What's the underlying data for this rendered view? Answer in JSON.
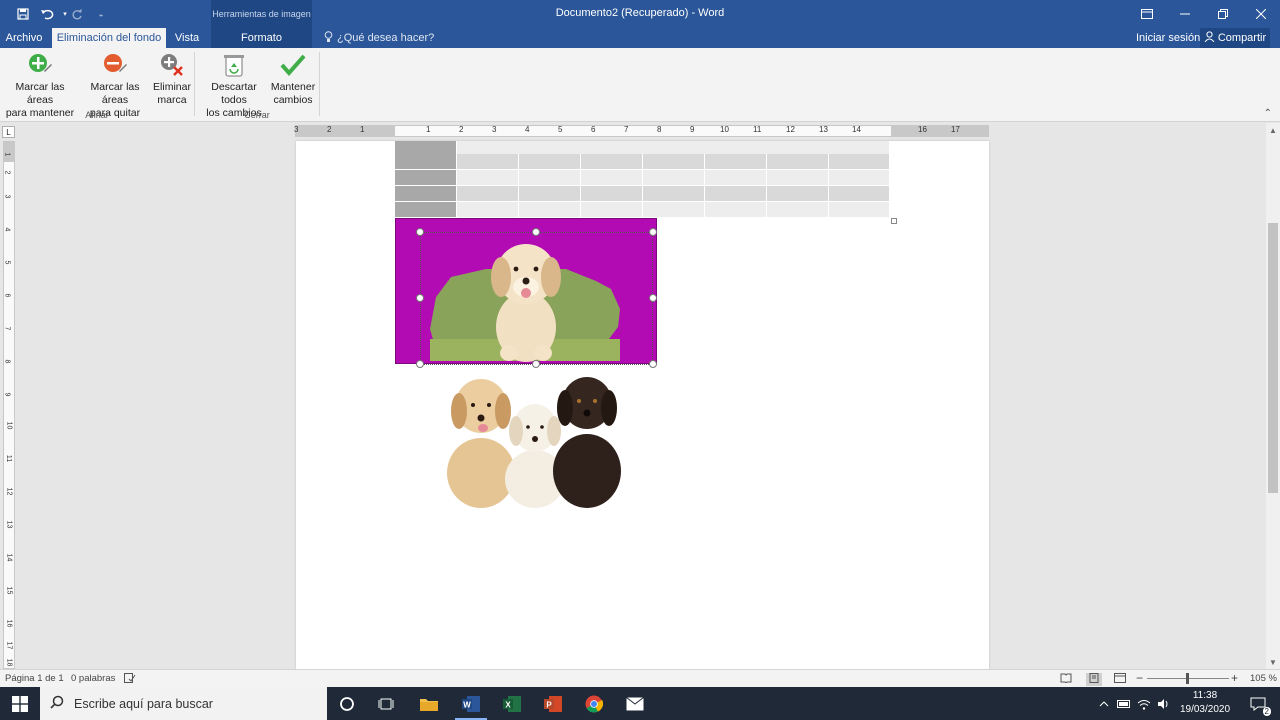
{
  "titlebar": {
    "document_title": "Documento2 (Recuperado)  -  Word",
    "contextual_header": "Herramientas de imagen",
    "qa_icons": [
      "save-icon",
      "undo-icon",
      "redo-icon",
      "customize-icon"
    ]
  },
  "tabs": {
    "archivo": "Archivo",
    "eliminacion": "Eliminación del fondo",
    "vista": "Vista",
    "formato": "Formato",
    "tell_me": "¿Qué desea hacer?",
    "sign_in": "Iniciar sesión",
    "share": "Compartir"
  },
  "ribbon": {
    "mark_keep": {
      "line1": "Marcar las áreas",
      "line2": "para mantener"
    },
    "mark_remove": {
      "line1": "Marcar las áreas",
      "line2": "para quitar"
    },
    "delete_mark": {
      "line1": "Eliminar",
      "line2": "marca"
    },
    "discard_all": {
      "line1": "Descartar todos",
      "line2": "los cambios"
    },
    "keep_changes": {
      "line1": "Mantener",
      "line2": "cambios"
    },
    "group_refine": "Afinar",
    "group_close": "Cerrar"
  },
  "ruler": {
    "tab_selector": "L",
    "numbers": [
      "3",
      "2",
      "1",
      "1",
      "2",
      "3",
      "4",
      "5",
      "6",
      "7",
      "8",
      "9",
      "10",
      "11",
      "12",
      "13",
      "14",
      "16",
      "17"
    ],
    "vnumbers": [
      "1",
      "2",
      "3",
      "4",
      "5",
      "6",
      "7",
      "8",
      "9",
      "10",
      "11",
      "12",
      "13",
      "14",
      "15",
      "16",
      "17",
      "18"
    ]
  },
  "statusbar": {
    "page": "Página 1 de 1",
    "words": "0 palabras",
    "zoom": "105 %",
    "zoom_minus": "−",
    "zoom_plus": "+"
  },
  "taskbar": {
    "search_placeholder": "Escribe aquí para buscar",
    "time": "11:38",
    "date": "19/03/2020",
    "notification_count": "2"
  },
  "colors": {
    "word_blue": "#2b579a",
    "removal_magenta": "#b30bb3"
  }
}
